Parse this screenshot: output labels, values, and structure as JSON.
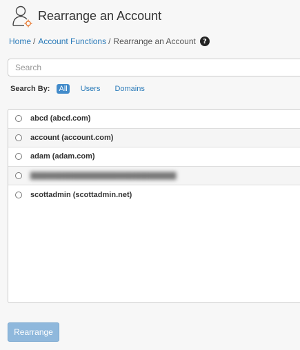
{
  "header": {
    "title": "Rearrange an Account",
    "icon": "user-icon"
  },
  "breadcrumb": {
    "items": [
      "Home",
      "Account Functions",
      "Rearrange an Account"
    ],
    "separator": "/",
    "help_icon": "?"
  },
  "search": {
    "placeholder": "Search",
    "value": "",
    "search_by_label": "Search By:",
    "filters": [
      "All",
      "Users",
      "Domains"
    ],
    "active_filter": "All"
  },
  "accounts": [
    {
      "label": "abcd (abcd.com)",
      "selected": false
    },
    {
      "label": "account (account.com)",
      "selected": false
    },
    {
      "label": "adam (adam.com)",
      "selected": false
    },
    {
      "label": "",
      "selected": false,
      "obscured": true
    },
    {
      "label": "scottadmin (scottadmin.net)",
      "selected": false
    }
  ],
  "actions": {
    "rearrange_label": "Rearrange"
  },
  "colors": {
    "link": "#2b7bb9",
    "active_filter_bg": "#428bca",
    "button_disabled_bg": "#8fb8dc"
  }
}
